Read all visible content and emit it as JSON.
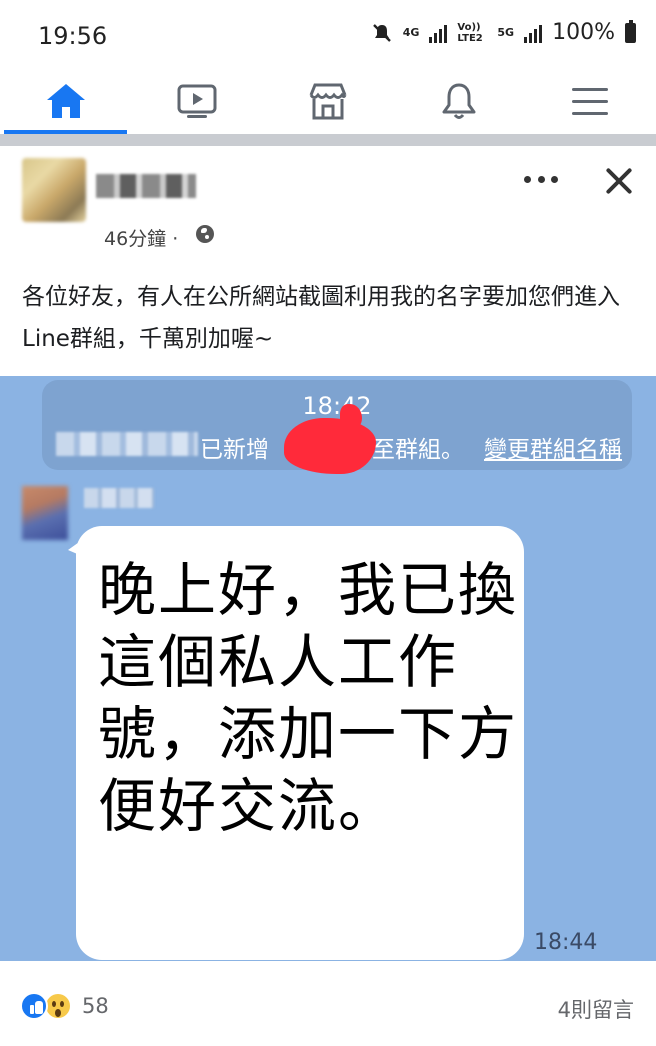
{
  "status_bar": {
    "time": "19:56",
    "network_4g": "4G",
    "volte": "Vo)) LTE2",
    "network_5g": "5G",
    "battery": "100%"
  },
  "nav": {
    "tabs": [
      {
        "name": "home",
        "icon": "home-icon",
        "active": true
      },
      {
        "name": "watch",
        "icon": "video-icon",
        "active": false
      },
      {
        "name": "marketplace",
        "icon": "store-icon",
        "active": false
      },
      {
        "name": "notifications",
        "icon": "bell-icon",
        "active": false
      },
      {
        "name": "menu",
        "icon": "hamburger-icon",
        "active": false
      }
    ],
    "accent_color": "#1877f2"
  },
  "post": {
    "time": "46分鐘 ·",
    "privacy_icon": "globe-icon",
    "text": "各位好友，有人在公所網站截圖利用我的名字要加您們進入Line群組，千萬別加喔~",
    "screenshot": {
      "system_time": "18:42",
      "system_text_a": "已新增",
      "system_text_b": "至群組。",
      "system_link": "變更群組名稱",
      "message": "晚上好，我已換這個私人工作號，添加一下方便好交流。",
      "message_time": "18:44"
    },
    "reactions": {
      "icons": [
        "like-icon",
        "wow-icon"
      ],
      "count": "58"
    },
    "comments": "4則留言"
  }
}
